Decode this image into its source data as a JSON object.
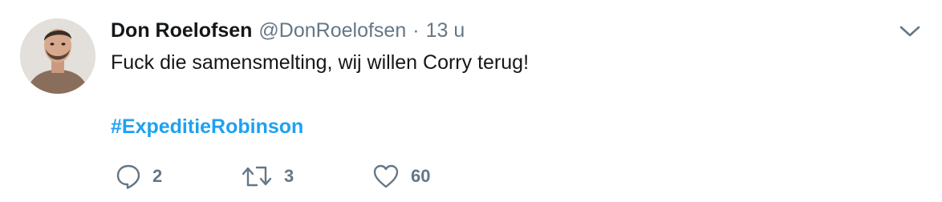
{
  "tweet": {
    "author": {
      "display_name": "Don Roelofsen",
      "handle": "@DonRoelofsen",
      "separator": "·",
      "time": "13 u"
    },
    "text": "Fuck die samensmelting, wij willen Corry terug!",
    "hashtag": "#ExpeditieRobinson",
    "actions": {
      "reply_count": "2",
      "retweet_count": "3",
      "like_count": "60"
    },
    "icons": {
      "reply": "reply-icon",
      "retweet": "retweet-icon",
      "like": "heart-icon",
      "menu": "chevron-down-icon"
    },
    "colors": {
      "link": "#1da1f2",
      "secondary": "#657786",
      "primary": "#14171a"
    }
  }
}
